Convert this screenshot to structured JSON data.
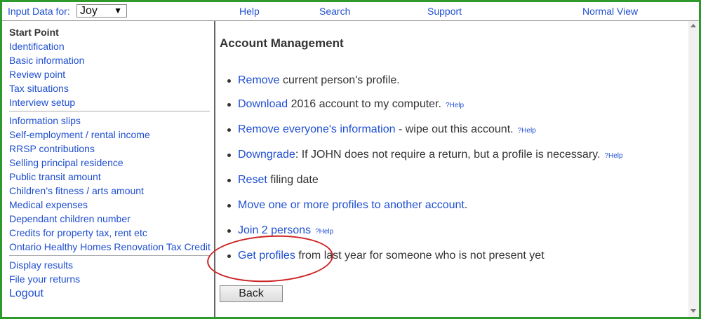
{
  "topbar": {
    "input_label": "Input Data for:",
    "person_selected": "Joy",
    "help": "Help",
    "search": "Search",
    "support": "Support",
    "normal_view": "Normal View"
  },
  "sidebar": {
    "group1": [
      "Start Point",
      "Identification",
      "Basic information",
      "Review point",
      "Tax situations",
      "Interview setup"
    ],
    "group2": [
      "Information slips",
      "Self-employment / rental income",
      "RRSP contributions",
      "Selling principal residence",
      "Public transit amount",
      "Children’s fitness / arts amount",
      "Medical expenses",
      "Dependant children number",
      "Credits for property tax, rent etc",
      "Ontario Healthy Homes Renovation Tax Credit"
    ],
    "group3": [
      "Display results",
      "File your returns",
      "Logout"
    ]
  },
  "main": {
    "title": "Account Management",
    "items": [
      {
        "link": "Remove",
        "text": " current person's profile.",
        "help": ""
      },
      {
        "link": "Download",
        "text": " 2016 account to my computer.",
        "help": "?Help"
      },
      {
        "link": "Remove everyone's information",
        "text": " - wipe out this account.",
        "help": "?Help"
      },
      {
        "link": "Downgrade",
        "text": ": If JOHN does not require a return, but a profile is necessary.",
        "help": "?Help"
      },
      {
        "link": "Reset",
        "text": " filing date",
        "help": ""
      },
      {
        "link": "Move one or more profiles to another account",
        "text": ".",
        "help": ""
      },
      {
        "link": "Join 2 persons",
        "text": "",
        "help": "?Help"
      },
      {
        "link": "Get profiles",
        "text": " from last year for someone who is not present yet",
        "help": ""
      }
    ],
    "back": "Back"
  },
  "colors": {
    "border": "#2e9a2e",
    "link": "#1f4fd1",
    "annotation": "#cc2222"
  }
}
